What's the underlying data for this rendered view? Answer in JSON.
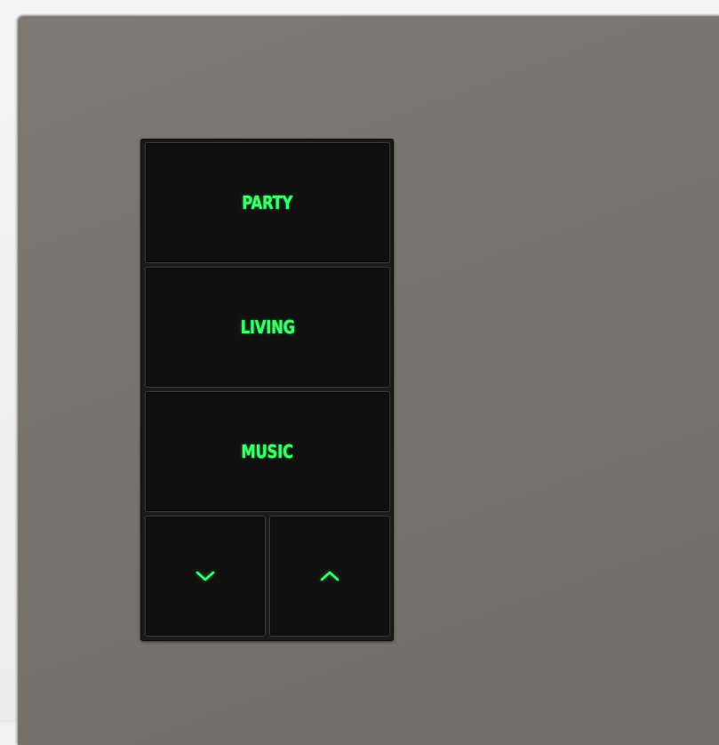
{
  "keypad": {
    "buttons": [
      {
        "label": "PARTY"
      },
      {
        "label": "LIVING"
      },
      {
        "label": "MUSIC"
      }
    ],
    "down_icon": "chevron-down-icon",
    "up_icon": "chevron-up-icon"
  },
  "colors": {
    "plate": "#79746e",
    "keypad": "#101010",
    "led_text": "#3dff6b"
  }
}
